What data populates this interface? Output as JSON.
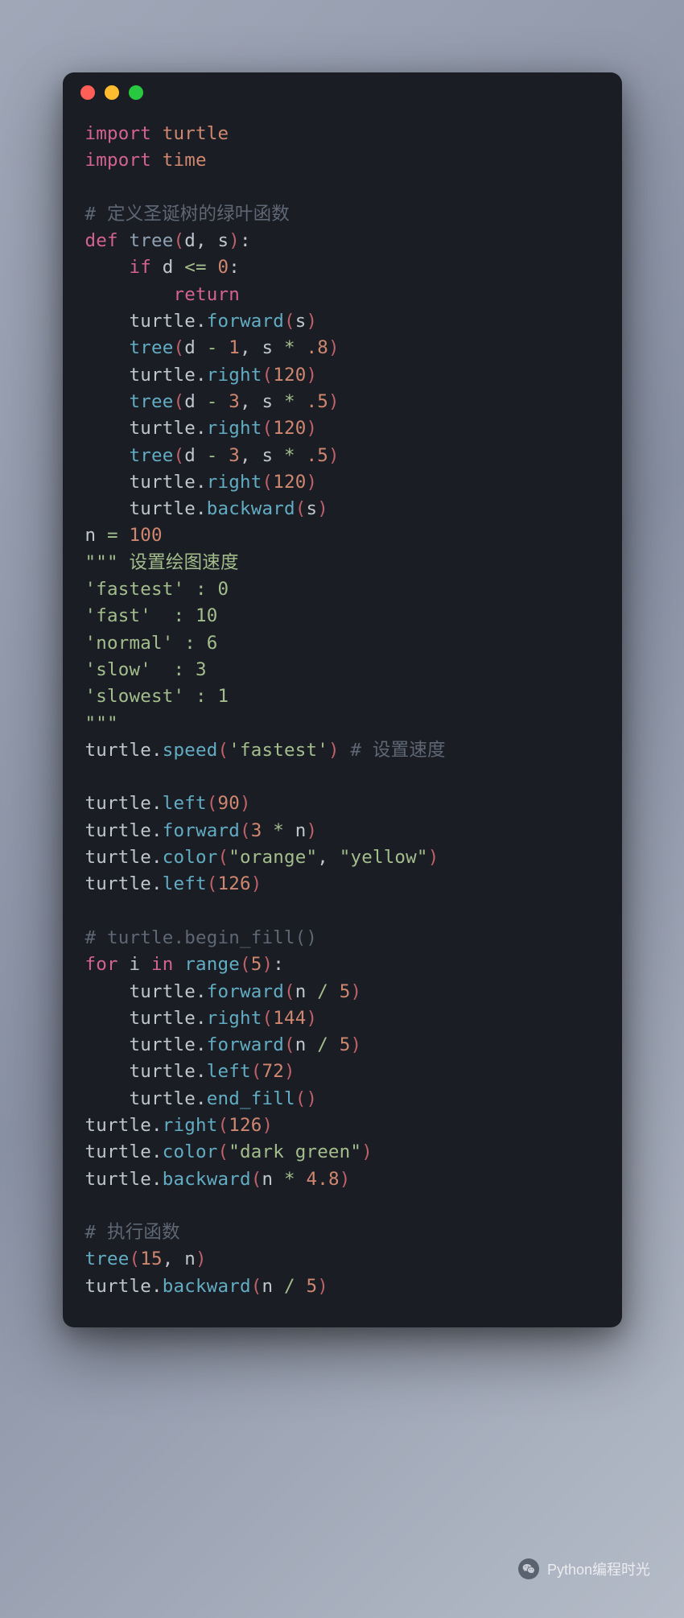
{
  "titlebar": {
    "dots": [
      "red",
      "yellow",
      "green"
    ]
  },
  "code": {
    "l1_kw": "import",
    "l1_mod": "turtle",
    "l2_kw": "import",
    "l2_mod": "time",
    "l4_cmt": "# 定义圣诞树的绿叶函数",
    "l5_def": "def",
    "l5_name": "tree",
    "l5_p1": "d",
    "l5_p2": "s",
    "l6_if": "if",
    "l6_var": "d",
    "l6_op": "<=",
    "l6_num": "0",
    "l7_ret": "return",
    "l8_obj": "turtle",
    "l8_fn": "forward",
    "l8_arg": "s",
    "l9_fn": "tree",
    "l9_a1": "d",
    "l9_op": "-",
    "l9_n1": "1",
    "l9_a2": "s",
    "l9_op2": "*",
    "l9_n2": ".8",
    "l10_obj": "turtle",
    "l10_fn": "right",
    "l10_n": "120",
    "l11_fn": "tree",
    "l11_a1": "d",
    "l11_op": "-",
    "l11_n1": "3",
    "l11_a2": "s",
    "l11_op2": "*",
    "l11_n2": ".5",
    "l12_obj": "turtle",
    "l12_fn": "right",
    "l12_n": "120",
    "l13_fn": "tree",
    "l13_a1": "d",
    "l13_op": "-",
    "l13_n1": "3",
    "l13_a2": "s",
    "l13_op2": "*",
    "l13_n2": ".5",
    "l14_obj": "turtle",
    "l14_fn": "right",
    "l14_n": "120",
    "l15_obj": "turtle",
    "l15_fn": "backward",
    "l15_arg": "s",
    "l16_var": "n",
    "l16_eq": "=",
    "l16_n": "100",
    "l17_q": "\"\"\"",
    "l17_txt": " 设置绘图速度",
    "l18": "'fastest' : 0",
    "l19": "'fast'  : 10",
    "l20": "'normal' : 6",
    "l21": "'slow'  : 3",
    "l22": "'slowest' : 1",
    "l23": "\"\"\"",
    "l24_obj": "turtle",
    "l24_fn": "speed",
    "l24_arg": "'fastest'",
    "l24_cmt": " # 设置速度",
    "l26_obj": "turtle",
    "l26_fn": "left",
    "l26_n": "90",
    "l27_obj": "turtle",
    "l27_fn": "forward",
    "l27_n1": "3",
    "l27_op": "*",
    "l27_v": "n",
    "l28_obj": "turtle",
    "l28_fn": "color",
    "l28_s1": "\"orange\"",
    "l28_s2": "\"yellow\"",
    "l29_obj": "turtle",
    "l29_fn": "left",
    "l29_n": "126",
    "l31_cmt": "# turtle.begin_fill()",
    "l32_for": "for",
    "l32_var": "i",
    "l32_in": "in",
    "l32_fn": "range",
    "l32_n": "5",
    "l33_obj": "turtle",
    "l33_fn": "forward",
    "l33_v": "n",
    "l33_op": "/",
    "l33_n": "5",
    "l34_obj": "turtle",
    "l34_fn": "right",
    "l34_n": "144",
    "l35_obj": "turtle",
    "l35_fn": "forward",
    "l35_v": "n",
    "l35_op": "/",
    "l35_n": "5",
    "l36_obj": "turtle",
    "l36_fn": "left",
    "l36_n": "72",
    "l37_obj": "turtle",
    "l37_fn": "end_fill",
    "l38_obj": "turtle",
    "l38_fn": "right",
    "l38_n": "126",
    "l39_obj": "turtle",
    "l39_fn": "color",
    "l39_s": "\"dark green\"",
    "l40_obj": "turtle",
    "l40_fn": "backward",
    "l40_v": "n",
    "l40_op": "*",
    "l40_n": "4.8",
    "l42_cmt": "# 执行函数",
    "l43_fn": "tree",
    "l43_n1": "15",
    "l43_v": "n",
    "l44_obj": "turtle",
    "l44_fn": "backward",
    "l44_v": "n",
    "l44_op": "/",
    "l44_n": "5"
  },
  "footer": {
    "text": "Python编程时光"
  }
}
